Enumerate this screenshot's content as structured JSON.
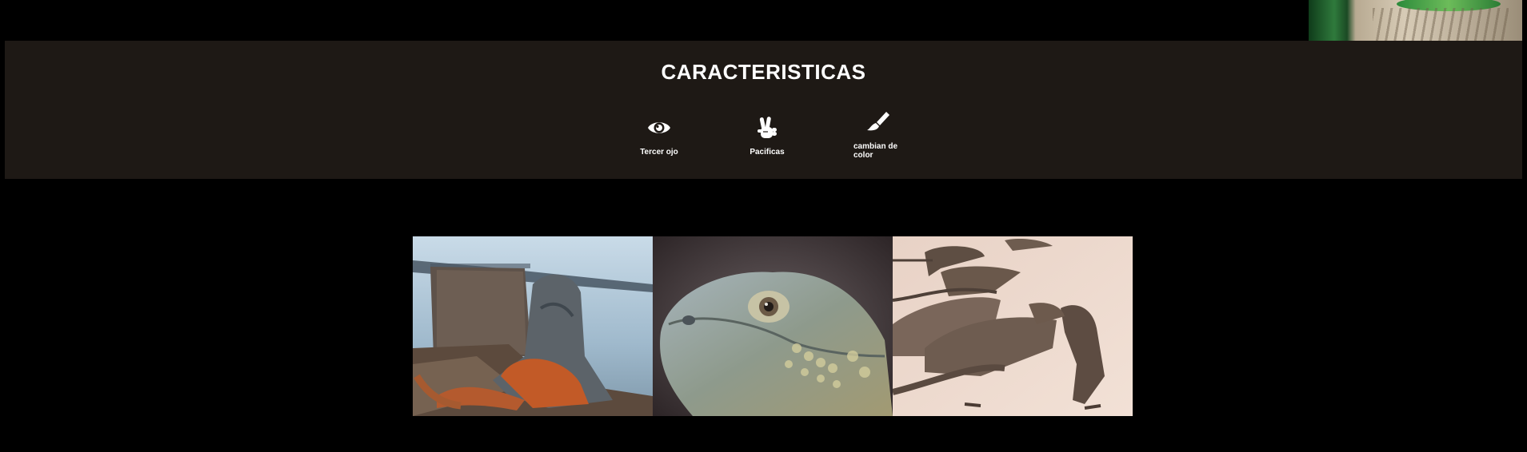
{
  "features": {
    "title": "CARACTERISTICAS",
    "items": [
      {
        "label": "Tercer ojo",
        "icon": "eye-icon"
      },
      {
        "label": "Pacificas",
        "icon": "peace-hand-icon"
      },
      {
        "label": "cambian de color",
        "icon": "paintbrush-icon"
      }
    ]
  },
  "gallery": {
    "images": [
      {
        "subject": "orange striped iguana on rocks by the water"
      },
      {
        "subject": "close-up of an iguana head"
      },
      {
        "subject": "group of iguanas on sand"
      }
    ]
  },
  "colors": {
    "page_background": "#000000",
    "band_background": "#1e1915",
    "text": "#ffffff"
  }
}
